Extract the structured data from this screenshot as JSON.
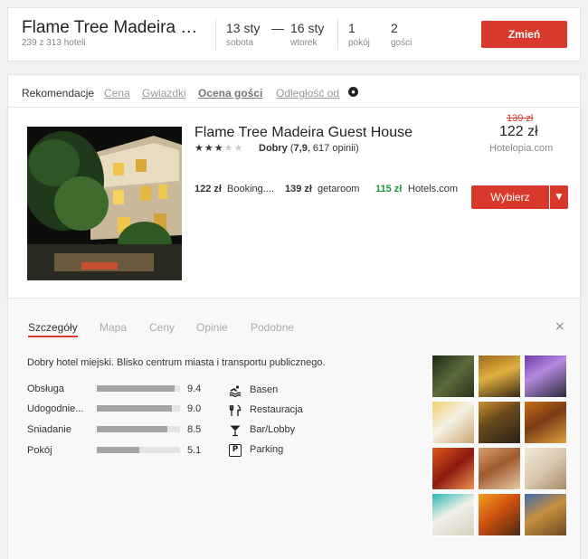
{
  "header": {
    "hotel_title": "Flame Tree Madeira G...",
    "hotel_count": "239 z 313 hoteli",
    "checkin_date": "13 sty",
    "checkin_day": "sobota",
    "dash": "—",
    "checkout_date": "16 sty",
    "checkout_day": "wtorek",
    "rooms_count": "1",
    "rooms_label": "pokój",
    "guests_count": "2",
    "guests_label": "gości",
    "change_label": "Zmień"
  },
  "sort": {
    "label": "Rekomendacje",
    "items": [
      "Cena",
      "Gwiazdki",
      "Ocena gości",
      "Odległość od"
    ],
    "active": "Ocena gości"
  },
  "result": {
    "name": "Flame Tree Madeira Guest House",
    "stars_filled": 3,
    "stars_total": 5,
    "rating_word": "Dobry",
    "rating_score": "7,9",
    "rating_reviews": ", 617 opinii)",
    "old_price": "139 zł",
    "price": "122 zł",
    "provider": "Hotelopia.com",
    "offers": [
      {
        "price": "122 zł",
        "source": "Booking....",
        "highlight": false
      },
      {
        "price": "139 zł",
        "source": "getaroom",
        "highlight": false
      },
      {
        "price": "115 zł",
        "source": "Hotels.com",
        "highlight": true
      }
    ],
    "select_label": "Wybierz",
    "highlight_color": "#1e9b47",
    "accent_color": "#d9392d"
  },
  "details": {
    "tabs": [
      "Szczegóły",
      "Mapa",
      "Ceny",
      "Opinie",
      "Podobne"
    ],
    "active_tab": "Szczegóły",
    "close": "×",
    "description": "Dobry hotel miejski. Blisko centrum miasta i transportu publicznego.",
    "scores": [
      {
        "label": "Obsługa",
        "value": "9.4",
        "fraction": 0.94
      },
      {
        "label": "Udogodnie...",
        "value": "9.0",
        "fraction": 0.9
      },
      {
        "label": "Śniadanie",
        "value": "8.5",
        "fraction": 0.85
      },
      {
        "label": "Pokój",
        "value": "5.1",
        "fraction": 0.51
      }
    ],
    "amenities": [
      {
        "label": "Basen",
        "icon": "swimming-icon"
      },
      {
        "label": "Restauracja",
        "icon": "restaurant-icon"
      },
      {
        "label": "Bar/Lobby",
        "icon": "cocktail-icon"
      },
      {
        "label": "Parking",
        "icon": "parking-icon",
        "glyph": "P"
      }
    ],
    "gallery_count": 12
  }
}
